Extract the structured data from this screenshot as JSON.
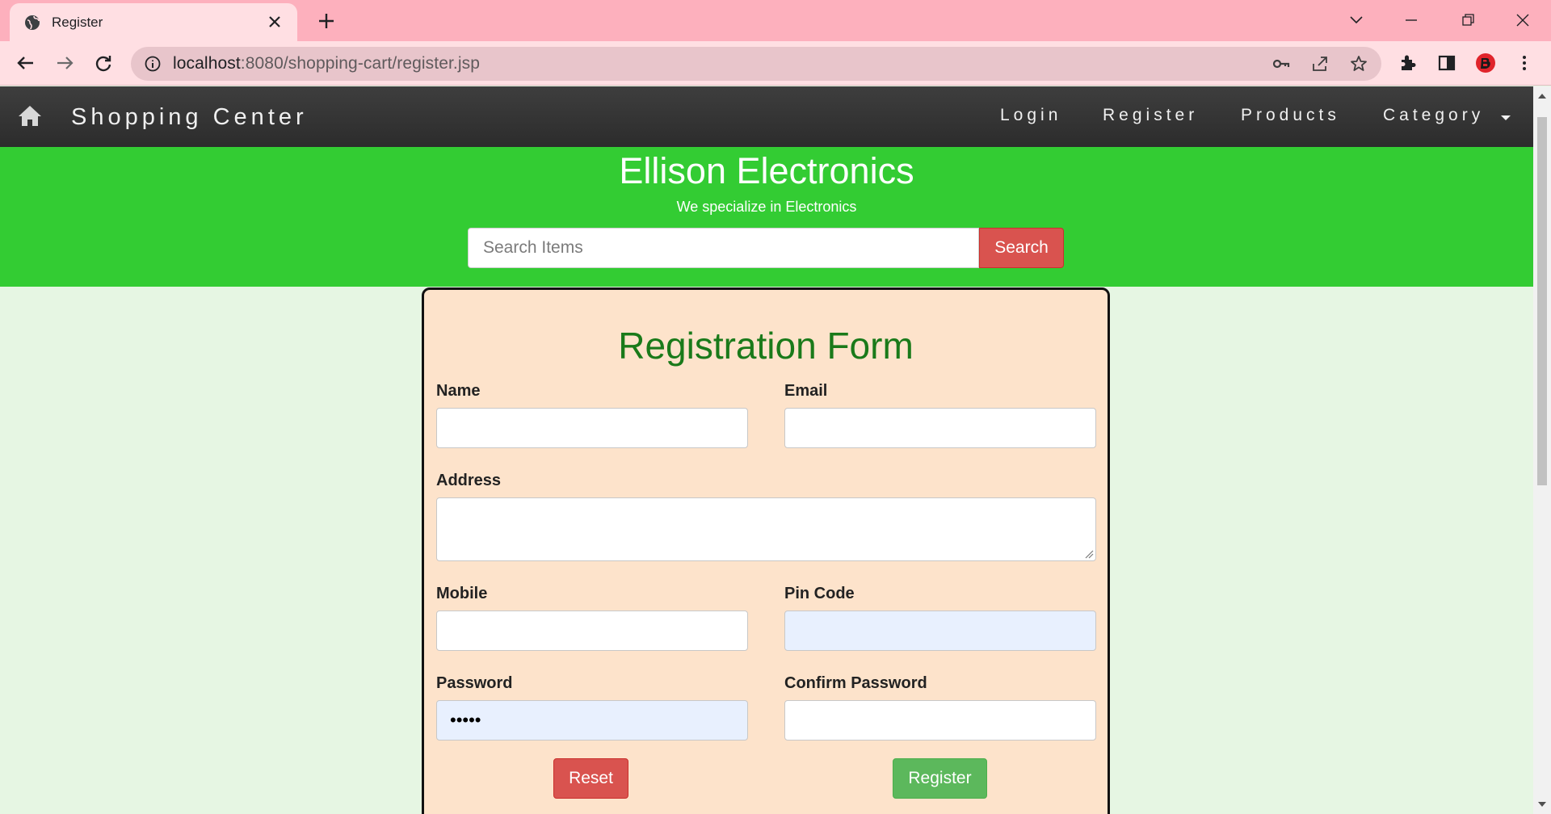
{
  "browser": {
    "tab_title": "Register",
    "url_host": "localhost",
    "url_rest": ":8080/shopping-cart/register.jsp",
    "colors": {
      "tabstrip": "#fdb0bd",
      "toolbar": "#ffdfe3"
    },
    "icons": [
      "globe-icon",
      "close-icon",
      "plus-icon",
      "back-arrow-icon",
      "forward-arrow-icon",
      "reload-icon",
      "info-icon",
      "key-icon",
      "share-icon",
      "star-icon",
      "puzzle-icon",
      "sidebar-icon",
      "profile-icon",
      "menu-icon",
      "chevron-down-icon",
      "minimize-icon",
      "restore-icon"
    ]
  },
  "navbar": {
    "brand": "Shopping Center",
    "items": [
      "Login",
      "Register",
      "Products",
      "Category"
    ]
  },
  "hero": {
    "title": "Ellison Electronics",
    "subtitle": "We specialize in Electronics",
    "search_placeholder": "Search Items",
    "search_button": "Search",
    "color": "#33cc33"
  },
  "form": {
    "title": "Registration Form",
    "labels": {
      "name": "Name",
      "email": "Email",
      "address": "Address",
      "mobile": "Mobile",
      "pincode": "Pin Code",
      "password": "Password",
      "confirm": "Confirm Password"
    },
    "values": {
      "name": "",
      "email": "",
      "address": "",
      "mobile": "",
      "pincode": "",
      "password": "•••••",
      "confirm": ""
    },
    "reset_button": "Reset",
    "register_button": "Register",
    "colors": {
      "title": "#1a7a1a",
      "card": "#fde3cb",
      "reset": "#d9534f",
      "register": "#5cb85c"
    }
  }
}
